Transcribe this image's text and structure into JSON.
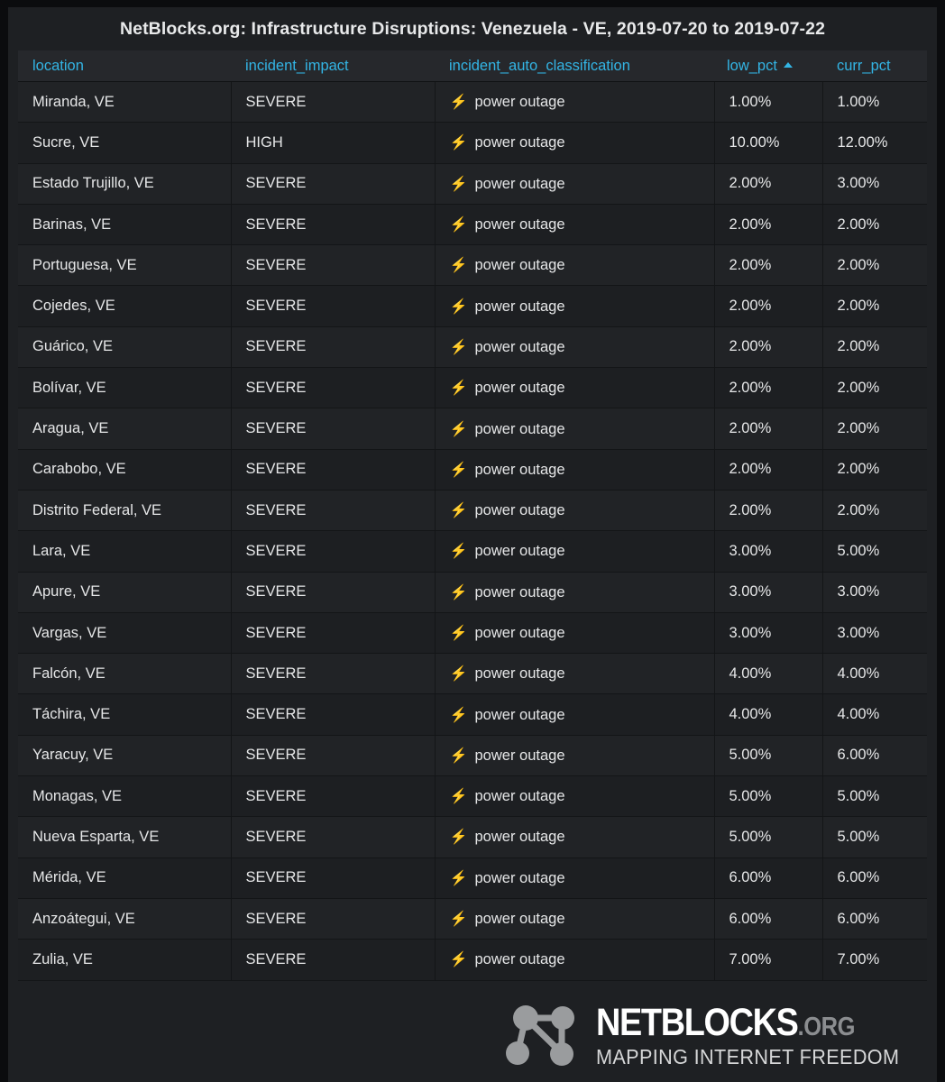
{
  "panel": {
    "title": "NetBlocks.org: Infrastructure Disruptions: Venezuela - VE, 2019-07-20 to 2019-07-22"
  },
  "table": {
    "columns": [
      {
        "key": "location",
        "label": "location",
        "sorted": false
      },
      {
        "key": "incident_impact",
        "label": "incident_impact",
        "sorted": false
      },
      {
        "key": "incident_auto_classification",
        "label": "incident_auto_classification",
        "sorted": false
      },
      {
        "key": "low_pct",
        "label": "low_pct",
        "sorted": true,
        "sort_direction": "asc"
      },
      {
        "key": "curr_pct",
        "label": "curr_pct",
        "sorted": false
      }
    ],
    "rows": [
      {
        "location": "Miranda, VE",
        "incident_impact": "SEVERE",
        "icon": "lightning-bolt-icon",
        "incident_auto_classification": "power outage",
        "low_pct": "1.00%",
        "curr_pct": "1.00%"
      },
      {
        "location": "Sucre, VE",
        "incident_impact": "HIGH",
        "icon": "lightning-bolt-icon",
        "incident_auto_classification": "power outage",
        "low_pct": "10.00%",
        "curr_pct": "12.00%"
      },
      {
        "location": "Estado Trujillo, VE",
        "incident_impact": "SEVERE",
        "icon": "lightning-bolt-icon",
        "incident_auto_classification": "power outage",
        "low_pct": "2.00%",
        "curr_pct": "3.00%"
      },
      {
        "location": "Barinas, VE",
        "incident_impact": "SEVERE",
        "icon": "lightning-bolt-icon",
        "incident_auto_classification": "power outage",
        "low_pct": "2.00%",
        "curr_pct": "2.00%"
      },
      {
        "location": "Portuguesa, VE",
        "incident_impact": "SEVERE",
        "icon": "lightning-bolt-icon",
        "incident_auto_classification": "power outage",
        "low_pct": "2.00%",
        "curr_pct": "2.00%"
      },
      {
        "location": "Cojedes, VE",
        "incident_impact": "SEVERE",
        "icon": "lightning-bolt-icon",
        "incident_auto_classification": "power outage",
        "low_pct": "2.00%",
        "curr_pct": "2.00%"
      },
      {
        "location": "Guárico, VE",
        "incident_impact": "SEVERE",
        "icon": "lightning-bolt-icon",
        "incident_auto_classification": "power outage",
        "low_pct": "2.00%",
        "curr_pct": "2.00%"
      },
      {
        "location": "Bolívar, VE",
        "incident_impact": "SEVERE",
        "icon": "lightning-bolt-icon",
        "incident_auto_classification": "power outage",
        "low_pct": "2.00%",
        "curr_pct": "2.00%"
      },
      {
        "location": "Aragua, VE",
        "incident_impact": "SEVERE",
        "icon": "lightning-bolt-icon",
        "incident_auto_classification": "power outage",
        "low_pct": "2.00%",
        "curr_pct": "2.00%"
      },
      {
        "location": "Carabobo, VE",
        "incident_impact": "SEVERE",
        "icon": "lightning-bolt-icon",
        "incident_auto_classification": "power outage",
        "low_pct": "2.00%",
        "curr_pct": "2.00%"
      },
      {
        "location": "Distrito Federal, VE",
        "incident_impact": "SEVERE",
        "icon": "lightning-bolt-icon",
        "incident_auto_classification": "power outage",
        "low_pct": "2.00%",
        "curr_pct": "2.00%"
      },
      {
        "location": "Lara, VE",
        "incident_impact": "SEVERE",
        "icon": "lightning-bolt-icon",
        "incident_auto_classification": "power outage",
        "low_pct": "3.00%",
        "curr_pct": "5.00%"
      },
      {
        "location": "Apure, VE",
        "incident_impact": "SEVERE",
        "icon": "lightning-bolt-icon",
        "incident_auto_classification": "power outage",
        "low_pct": "3.00%",
        "curr_pct": "3.00%"
      },
      {
        "location": "Vargas, VE",
        "incident_impact": "SEVERE",
        "icon": "lightning-bolt-icon",
        "incident_auto_classification": "power outage",
        "low_pct": "3.00%",
        "curr_pct": "3.00%"
      },
      {
        "location": "Falcón, VE",
        "incident_impact": "SEVERE",
        "icon": "lightning-bolt-icon",
        "incident_auto_classification": "power outage",
        "low_pct": "4.00%",
        "curr_pct": "4.00%"
      },
      {
        "location": "Táchira, VE",
        "incident_impact": "SEVERE",
        "icon": "lightning-bolt-icon",
        "incident_auto_classification": "power outage",
        "low_pct": "4.00%",
        "curr_pct": "4.00%"
      },
      {
        "location": "Yaracuy, VE",
        "incident_impact": "SEVERE",
        "icon": "lightning-bolt-icon",
        "incident_auto_classification": "power outage",
        "low_pct": "5.00%",
        "curr_pct": "6.00%"
      },
      {
        "location": "Monagas, VE",
        "incident_impact": "SEVERE",
        "icon": "lightning-bolt-icon",
        "incident_auto_classification": "power outage",
        "low_pct": "5.00%",
        "curr_pct": "5.00%"
      },
      {
        "location": "Nueva Esparta, VE",
        "incident_impact": "SEVERE",
        "icon": "lightning-bolt-icon",
        "incident_auto_classification": "power outage",
        "low_pct": "5.00%",
        "curr_pct": "5.00%"
      },
      {
        "location": "Mérida, VE",
        "incident_impact": "SEVERE",
        "icon": "lightning-bolt-icon",
        "incident_auto_classification": "power outage",
        "low_pct": "6.00%",
        "curr_pct": "6.00%"
      },
      {
        "location": "Anzoátegui, VE",
        "incident_impact": "SEVERE",
        "icon": "lightning-bolt-icon",
        "incident_auto_classification": "power outage",
        "low_pct": "6.00%",
        "curr_pct": "6.00%"
      },
      {
        "location": "Zulia, VE",
        "incident_impact": "SEVERE",
        "icon": "lightning-bolt-icon",
        "incident_auto_classification": "power outage",
        "low_pct": "7.00%",
        "curr_pct": "7.00%"
      }
    ]
  },
  "logo": {
    "brand": "NETBLOCKS",
    "tld": ".ORG",
    "tagline": "MAPPING INTERNET FREEDOM",
    "mark": "network-nodes-icon"
  },
  "colors": {
    "page_background": "#0b0c0e",
    "panel_background": "#1e2023",
    "header_background": "#26282c",
    "row_background": "#212326",
    "row_alt_background": "#1d1f22",
    "header_text": "#33b5e5",
    "body_text": "#e6e7e8",
    "bolt": "#f6c026",
    "logo_node": "#9a9c9e"
  }
}
